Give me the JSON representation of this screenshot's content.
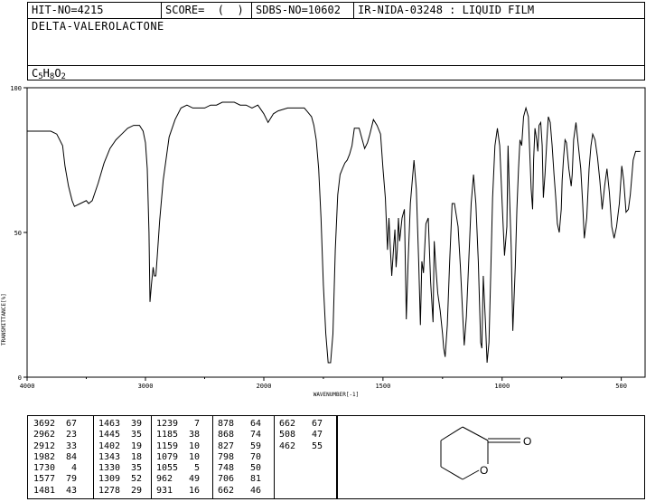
{
  "header": {
    "hit_no": "HIT-NO=4215",
    "score": "SCORE=  (  )",
    "sdbs_no": "SDBS-NO=10602",
    "ir_id": "IR-NIDA-03248 : LIQUID FILM",
    "compound": "DELTA-VALEROLACTONE",
    "formula": {
      "c": "C",
      "c_n": "5",
      "h": "H",
      "h_n": "8",
      "o": "O",
      "o_n": "2"
    }
  },
  "chart_data": {
    "type": "line",
    "xlabel": "WAVENUMBER[-1]",
    "ylabel": "TRANSMITTANCE[%]",
    "xlim": [
      4000,
      400
    ],
    "ylim": [
      0,
      100
    ],
    "xticks": [
      "4000",
      "3000",
      "2000",
      "1500",
      "1000",
      "500"
    ],
    "yticks": [
      "0",
      "50",
      "100"
    ],
    "x": [
      4000,
      3900,
      3800,
      3750,
      3700,
      3680,
      3650,
      3620,
      3600,
      3550,
      3500,
      3480,
      3450,
      3400,
      3350,
      3300,
      3250,
      3200,
      3150,
      3100,
      3050,
      3020,
      3000,
      2985,
      2970,
      2962,
      2950,
      2935,
      2925,
      2912,
      2900,
      2880,
      2850,
      2800,
      2750,
      2700,
      2650,
      2600,
      2550,
      2500,
      2450,
      2400,
      2350,
      2300,
      2250,
      2200,
      2150,
      2100,
      2050,
      2000,
      1982,
      1960,
      1940,
      1900,
      1880,
      1860,
      1850,
      1840,
      1830,
      1820,
      1800,
      1790,
      1780,
      1770,
      1760,
      1750,
      1740,
      1730,
      1720,
      1710,
      1700,
      1690,
      1680,
      1670,
      1660,
      1650,
      1640,
      1630,
      1620,
      1600,
      1590,
      1577,
      1565,
      1555,
      1540,
      1525,
      1510,
      1500,
      1490,
      1481,
      1475,
      1470,
      1463,
      1455,
      1450,
      1445,
      1440,
      1435,
      1430,
      1420,
      1410,
      1402,
      1395,
      1385,
      1370,
      1360,
      1350,
      1343,
      1337,
      1330,
      1320,
      1310,
      1300,
      1290,
      1285,
      1278,
      1270,
      1260,
      1250,
      1245,
      1239,
      1230,
      1220,
      1210,
      1200,
      1185,
      1175,
      1165,
      1159,
      1150,
      1140,
      1130,
      1120,
      1110,
      1100,
      1090,
      1085,
      1079,
      1070,
      1063,
      1055,
      1048,
      1040,
      1030,
      1020,
      1010,
      1000,
      990,
      980,
      975,
      970,
      962,
      955,
      945,
      938,
      931,
      925,
      918,
      910,
      900,
      890,
      878,
      872,
      868,
      862,
      855,
      850,
      845,
      838,
      832,
      827,
      820,
      812,
      806,
      798,
      790,
      782,
      775,
      768,
      760,
      752,
      748,
      742,
      736,
      730,
      720,
      710,
      706,
      700,
      695,
      690,
      685,
      680,
      670,
      662,
      655,
      645,
      635,
      627,
      620,
      610,
      600,
      590,
      580,
      570,
      560,
      550,
      540,
      530,
      520,
      508,
      498,
      490,
      480,
      470,
      462,
      455,
      450,
      440,
      430,
      420,
      410,
      400
    ],
    "values": [
      85,
      85,
      85,
      84,
      80,
      73,
      66,
      61,
      59,
      60,
      61,
      60,
      61,
      67,
      74,
      79,
      82,
      84,
      86,
      87,
      87,
      85,
      81,
      72,
      50,
      26,
      32,
      38,
      35,
      35,
      42,
      54,
      68,
      83,
      89,
      93,
      94,
      93,
      93,
      93,
      94,
      94,
      95,
      95,
      95,
      94,
      94,
      93,
      94,
      91,
      88,
      91,
      92,
      93,
      93,
      93,
      93,
      93,
      93,
      92,
      90,
      87,
      82,
      72,
      55,
      32,
      15,
      5,
      5,
      15,
      44,
      63,
      70,
      72,
      74,
      75,
      77,
      80,
      86,
      86,
      83,
      79,
      81,
      84,
      89,
      87,
      84,
      72,
      62,
      44,
      55,
      46,
      35,
      45,
      51,
      38,
      44,
      55,
      47,
      55,
      58,
      20,
      39,
      60,
      75,
      65,
      40,
      18,
      40,
      36,
      53,
      55,
      33,
      19,
      47,
      38,
      29,
      23,
      15,
      10,
      7,
      18,
      40,
      60,
      60,
      52,
      38,
      21,
      11,
      21,
      40,
      60,
      70,
      60,
      40,
      12,
      10,
      35,
      19,
      5,
      12,
      35,
      62,
      80,
      86,
      80,
      60,
      42,
      52,
      80,
      65,
      45,
      16,
      38,
      58,
      72,
      82,
      80,
      90,
      93,
      90,
      65,
      58,
      75,
      86,
      82,
      78,
      87,
      88,
      80,
      62,
      70,
      82,
      90,
      88,
      80,
      70,
      62,
      53,
      50,
      58,
      68,
      76,
      82,
      81,
      72,
      66,
      70,
      82,
      85,
      88,
      84,
      80,
      72,
      60,
      48,
      55,
      72,
      80,
      84,
      82,
      76,
      68,
      58,
      66,
      72,
      64,
      52,
      48,
      52,
      60,
      73,
      68,
      57,
      58,
      63,
      70,
      75,
      78,
      78,
      78
    ]
  },
  "peaks": [
    [
      "3692",
      "67"
    ],
    [
      "2962",
      "23"
    ],
    [
      "2912",
      "33"
    ],
    [
      "1982",
      "84"
    ],
    [
      "1730",
      "4"
    ],
    [
      "1577",
      "79"
    ],
    [
      "1481",
      "43"
    ],
    [
      "1463",
      "39"
    ],
    [
      "1445",
      "35"
    ],
    [
      "1402",
      "19"
    ],
    [
      "1343",
      "18"
    ],
    [
      "1330",
      "35"
    ],
    [
      "1309",
      "52"
    ],
    [
      "1278",
      "29"
    ],
    [
      "1239",
      "7"
    ],
    [
      "1185",
      "38"
    ],
    [
      "1159",
      "10"
    ],
    [
      "1079",
      "10"
    ],
    [
      "1055",
      "5"
    ],
    [
      "962",
      "49"
    ],
    [
      "931",
      "16"
    ],
    [
      "878",
      "64"
    ],
    [
      "868",
      "74"
    ],
    [
      "827",
      "59"
    ],
    [
      "798",
      "70"
    ],
    [
      "748",
      "50"
    ],
    [
      "706",
      "81"
    ],
    [
      "662",
      "46"
    ],
    [
      "662",
      "67"
    ],
    [
      "508",
      "47"
    ],
    [
      "462",
      "55"
    ]
  ],
  "structure": {
    "carbonyl_o": "O",
    "ring_o": "O"
  }
}
